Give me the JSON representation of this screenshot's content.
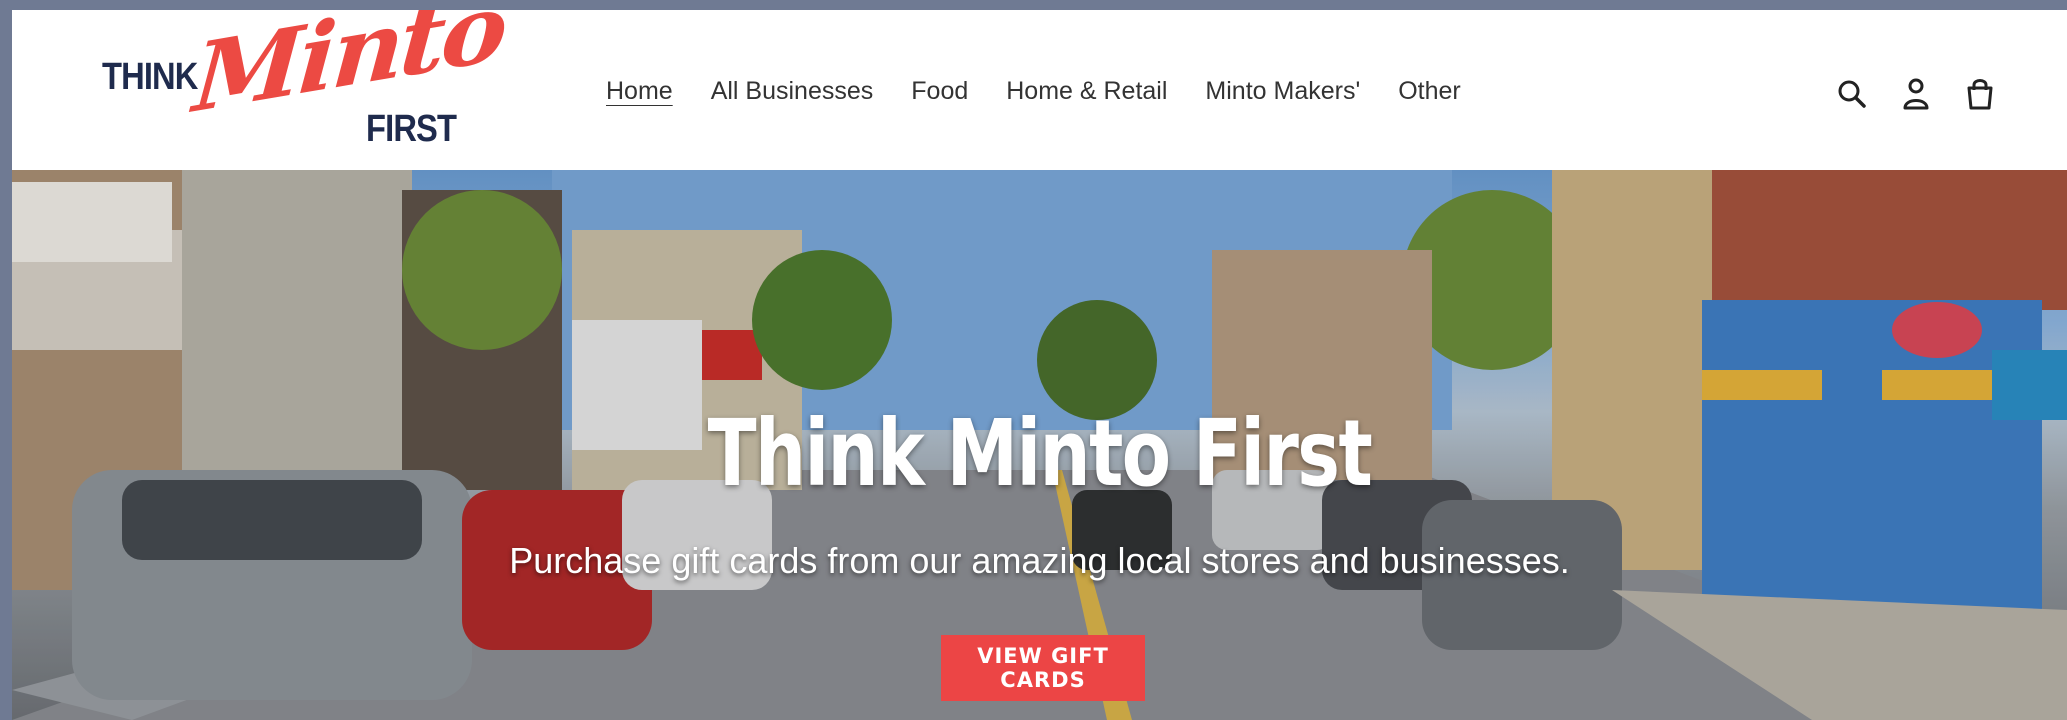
{
  "logo": {
    "think": "THINK",
    "minto": "Minto",
    "first": "FIRST"
  },
  "nav": {
    "items": [
      "Home",
      "All Businesses",
      "Food",
      "Home & Retail",
      "Minto Makers'",
      "Other"
    ],
    "active": "Home"
  },
  "header_icons": [
    "search-icon",
    "account-icon",
    "cart-icon"
  ],
  "hero": {
    "title": "Think Minto First",
    "subtitle": "Purchase gift cards from our amazing local stores and businesses.",
    "button_label": "VIEW GIFT CARDS"
  },
  "colors": {
    "brand_red": "#ec4545",
    "brand_navy": "#1f2b4d"
  }
}
